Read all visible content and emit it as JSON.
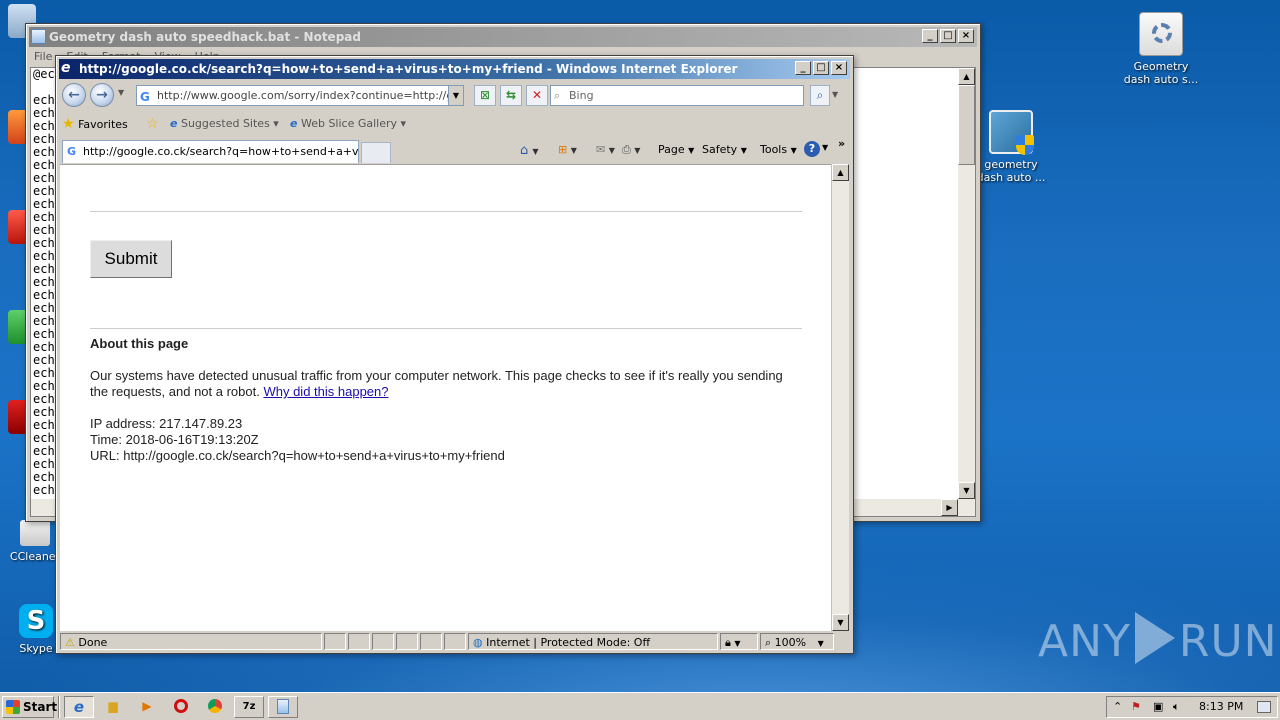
{
  "desktop": {
    "icons": [
      {
        "label_line1": "Geometry",
        "label_line2": "dash auto s..."
      },
      {
        "label_line1": "geometry",
        "label_line2": "dash auto ..."
      },
      {
        "label_line1": "CCleaner",
        "label_line2": ""
      },
      {
        "label_line1": "Skype",
        "label_line2": ""
      }
    ],
    "watermark": {
      "left": "ANY",
      "right": "RUN"
    }
  },
  "notepad": {
    "title": "Geometry dash auto speedhack.bat - Notepad",
    "menu": [
      "File",
      "Edit",
      "Format",
      "View",
      "Help"
    ],
    "first_line": "@ec",
    "line_prefix": "ech"
  },
  "ie": {
    "title": "http://google.co.ck/search?q=how+to+send+a+virus+to+my+friend - Windows Internet Explorer",
    "address": "http://www.google.com/sorry/index?continue=http://google",
    "search_placeholder": "Bing",
    "favorites_label": "Favorites",
    "suggested_sites": "Suggested Sites",
    "web_slice_gallery": "Web Slice Gallery",
    "tab_title": "http://google.co.ck/search?q=how+to+send+a+viru...",
    "commands": {
      "page": "Page",
      "safety": "Safety",
      "tools": "Tools"
    },
    "status_text": "Done",
    "zone_text": "Internet | Protected Mode: Off",
    "zoom": "100%"
  },
  "page": {
    "submit_label": "Submit",
    "about_heading": "About this page",
    "paragraph": "Our systems have detected unusual traffic from your computer network. This page checks to see if it's really you sending the requests, and not a robot.",
    "why_link": "Why did this happen?",
    "ip_line": "IP address: 217.147.89.23",
    "time_line": "Time: 2018-06-16T19:13:20Z",
    "url_line": "URL: http://google.co.ck/search?q=how+to+send+a+virus+to+my+friend"
  },
  "taskbar": {
    "start_label": "Start",
    "clock": "8:13 PM"
  }
}
